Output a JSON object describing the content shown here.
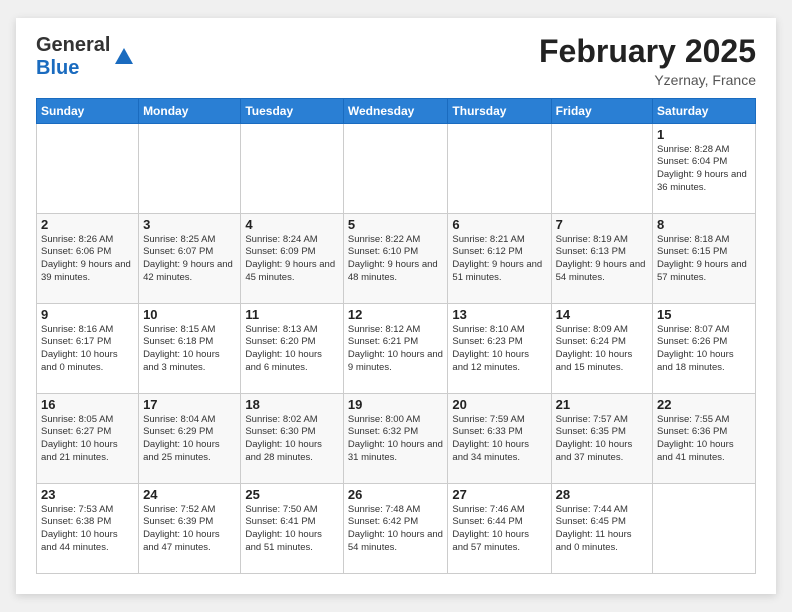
{
  "header": {
    "logo_general": "General",
    "logo_blue": "Blue",
    "month_title": "February 2025",
    "location": "Yzernay, France"
  },
  "days_of_week": [
    "Sunday",
    "Monday",
    "Tuesday",
    "Wednesday",
    "Thursday",
    "Friday",
    "Saturday"
  ],
  "weeks": [
    [
      {
        "day": "",
        "info": ""
      },
      {
        "day": "",
        "info": ""
      },
      {
        "day": "",
        "info": ""
      },
      {
        "day": "",
        "info": ""
      },
      {
        "day": "",
        "info": ""
      },
      {
        "day": "",
        "info": ""
      },
      {
        "day": "1",
        "info": "Sunrise: 8:28 AM\nSunset: 6:04 PM\nDaylight: 9 hours and 36 minutes."
      }
    ],
    [
      {
        "day": "2",
        "info": "Sunrise: 8:26 AM\nSunset: 6:06 PM\nDaylight: 9 hours and 39 minutes."
      },
      {
        "day": "3",
        "info": "Sunrise: 8:25 AM\nSunset: 6:07 PM\nDaylight: 9 hours and 42 minutes."
      },
      {
        "day": "4",
        "info": "Sunrise: 8:24 AM\nSunset: 6:09 PM\nDaylight: 9 hours and 45 minutes."
      },
      {
        "day": "5",
        "info": "Sunrise: 8:22 AM\nSunset: 6:10 PM\nDaylight: 9 hours and 48 minutes."
      },
      {
        "day": "6",
        "info": "Sunrise: 8:21 AM\nSunset: 6:12 PM\nDaylight: 9 hours and 51 minutes."
      },
      {
        "day": "7",
        "info": "Sunrise: 8:19 AM\nSunset: 6:13 PM\nDaylight: 9 hours and 54 minutes."
      },
      {
        "day": "8",
        "info": "Sunrise: 8:18 AM\nSunset: 6:15 PM\nDaylight: 9 hours and 57 minutes."
      }
    ],
    [
      {
        "day": "9",
        "info": "Sunrise: 8:16 AM\nSunset: 6:17 PM\nDaylight: 10 hours and 0 minutes."
      },
      {
        "day": "10",
        "info": "Sunrise: 8:15 AM\nSunset: 6:18 PM\nDaylight: 10 hours and 3 minutes."
      },
      {
        "day": "11",
        "info": "Sunrise: 8:13 AM\nSunset: 6:20 PM\nDaylight: 10 hours and 6 minutes."
      },
      {
        "day": "12",
        "info": "Sunrise: 8:12 AM\nSunset: 6:21 PM\nDaylight: 10 hours and 9 minutes."
      },
      {
        "day": "13",
        "info": "Sunrise: 8:10 AM\nSunset: 6:23 PM\nDaylight: 10 hours and 12 minutes."
      },
      {
        "day": "14",
        "info": "Sunrise: 8:09 AM\nSunset: 6:24 PM\nDaylight: 10 hours and 15 minutes."
      },
      {
        "day": "15",
        "info": "Sunrise: 8:07 AM\nSunset: 6:26 PM\nDaylight: 10 hours and 18 minutes."
      }
    ],
    [
      {
        "day": "16",
        "info": "Sunrise: 8:05 AM\nSunset: 6:27 PM\nDaylight: 10 hours and 21 minutes."
      },
      {
        "day": "17",
        "info": "Sunrise: 8:04 AM\nSunset: 6:29 PM\nDaylight: 10 hours and 25 minutes."
      },
      {
        "day": "18",
        "info": "Sunrise: 8:02 AM\nSunset: 6:30 PM\nDaylight: 10 hours and 28 minutes."
      },
      {
        "day": "19",
        "info": "Sunrise: 8:00 AM\nSunset: 6:32 PM\nDaylight: 10 hours and 31 minutes."
      },
      {
        "day": "20",
        "info": "Sunrise: 7:59 AM\nSunset: 6:33 PM\nDaylight: 10 hours and 34 minutes."
      },
      {
        "day": "21",
        "info": "Sunrise: 7:57 AM\nSunset: 6:35 PM\nDaylight: 10 hours and 37 minutes."
      },
      {
        "day": "22",
        "info": "Sunrise: 7:55 AM\nSunset: 6:36 PM\nDaylight: 10 hours and 41 minutes."
      }
    ],
    [
      {
        "day": "23",
        "info": "Sunrise: 7:53 AM\nSunset: 6:38 PM\nDaylight: 10 hours and 44 minutes."
      },
      {
        "day": "24",
        "info": "Sunrise: 7:52 AM\nSunset: 6:39 PM\nDaylight: 10 hours and 47 minutes."
      },
      {
        "day": "25",
        "info": "Sunrise: 7:50 AM\nSunset: 6:41 PM\nDaylight: 10 hours and 51 minutes."
      },
      {
        "day": "26",
        "info": "Sunrise: 7:48 AM\nSunset: 6:42 PM\nDaylight: 10 hours and 54 minutes."
      },
      {
        "day": "27",
        "info": "Sunrise: 7:46 AM\nSunset: 6:44 PM\nDaylight: 10 hours and 57 minutes."
      },
      {
        "day": "28",
        "info": "Sunrise: 7:44 AM\nSunset: 6:45 PM\nDaylight: 11 hours and 0 minutes."
      },
      {
        "day": "",
        "info": ""
      }
    ]
  ]
}
